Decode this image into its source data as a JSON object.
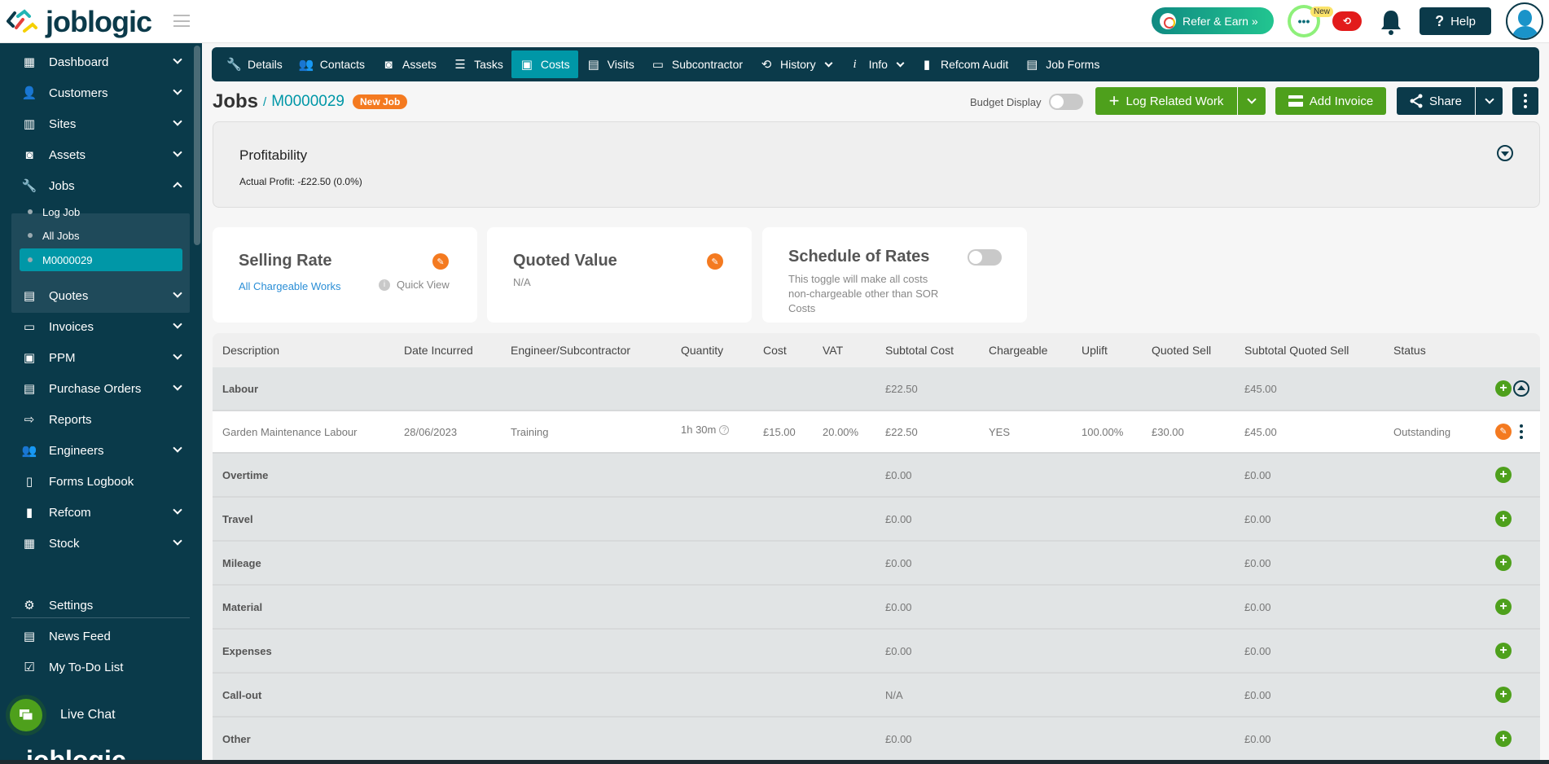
{
  "app": {
    "logo_text": "joblogic"
  },
  "topbar": {
    "refer_label": "Refer & Earn »",
    "chat_badge": "New",
    "chat_icon_text": "•••",
    "sync_icon_text": "⟲",
    "help_label": "Help",
    "help_icon": "?"
  },
  "sidebar": {
    "items": [
      {
        "label": "Dashboard",
        "icon": "▦"
      },
      {
        "label": "Customers",
        "icon": "👤"
      },
      {
        "label": "Sites",
        "icon": "▥"
      },
      {
        "label": "Assets",
        "icon": "◙"
      },
      {
        "label": "Jobs",
        "icon": "🔧"
      },
      {
        "label": "Quotes",
        "icon": "▤"
      },
      {
        "label": "Invoices",
        "icon": "▭"
      },
      {
        "label": "PPM",
        "icon": "▣"
      },
      {
        "label": "Purchase Orders",
        "icon": "▤"
      },
      {
        "label": "Reports",
        "icon": "⇨"
      },
      {
        "label": "Engineers",
        "icon": "👥"
      },
      {
        "label": "Forms Logbook",
        "icon": "▯"
      },
      {
        "label": "Refcom",
        "icon": "▮"
      },
      {
        "label": "Stock",
        "icon": "▦"
      }
    ],
    "jobs_sub": [
      {
        "label": "Log Job"
      },
      {
        "label": "All Jobs"
      },
      {
        "label": "M0000029"
      }
    ],
    "bottom": [
      {
        "label": "Settings",
        "icon": "⚙"
      },
      {
        "label": "News Feed",
        "icon": "▤"
      },
      {
        "label": "My To-Do List",
        "icon": "☑"
      }
    ],
    "live_chat": "Live Chat",
    "bottom_logo": "joblogic"
  },
  "tabs": [
    {
      "label": "Details",
      "icon": "🔧"
    },
    {
      "label": "Contacts",
      "icon": "👥"
    },
    {
      "label": "Assets",
      "icon": "◙"
    },
    {
      "label": "Tasks",
      "icon": "☰"
    },
    {
      "label": "Costs",
      "icon": "▣"
    },
    {
      "label": "Visits",
      "icon": "▤"
    },
    {
      "label": "Subcontractor",
      "icon": "▭"
    },
    {
      "label": "History",
      "icon": "⟲"
    },
    {
      "label": "Info",
      "icon": "i"
    },
    {
      "label": "Refcom Audit",
      "icon": "▮"
    },
    {
      "label": "Job Forms",
      "icon": "▤"
    }
  ],
  "header": {
    "section": "Jobs",
    "separator": "/",
    "job_id": "M0000029",
    "status_badge": "New Job",
    "budget_display_label": "Budget Display",
    "log_related_work": "Log Related Work",
    "add_invoice": "Add Invoice",
    "share": "Share"
  },
  "profitability": {
    "title": "Profitability",
    "actual_profit": "Actual Profit: -£22.50 (0.0%)"
  },
  "cards": {
    "selling_rate": {
      "title": "Selling Rate",
      "link": "All Chargeable Works",
      "quick_view": "Quick View"
    },
    "quoted_value": {
      "title": "Quoted Value",
      "value": "N/A"
    },
    "schedule_of_rates": {
      "title": "Schedule of Rates",
      "description": "This toggle will make all costs non-chargeable other than SOR Costs",
      "enabled": false
    }
  },
  "table": {
    "columns": [
      "Description",
      "Date Incurred",
      "Engineer/Subcontractor",
      "Quantity",
      "Cost",
      "VAT",
      "Subtotal Cost",
      "Chargeable",
      "Uplift",
      "Quoted Sell",
      "Subtotal Quoted Sell",
      "Status"
    ],
    "labour": {
      "name": "Labour",
      "subtotal_cost": "£22.50",
      "subtotal_quoted_sell": "£45.00"
    },
    "labour_item": {
      "description": "Garden Maintenance Labour",
      "date": "28/06/2023",
      "engineer": "Training",
      "quantity": "1h 30m",
      "cost": "£15.00",
      "vat": "20.00%",
      "subtotal_cost": "£22.50",
      "chargeable": "YES",
      "uplift": "100.00%",
      "quoted_sell": "£30.00",
      "subtotal_quoted_sell": "£45.00",
      "status": "Outstanding"
    },
    "categories": [
      {
        "name": "Overtime",
        "subtotal_cost": "£0.00",
        "subtotal_quoted_sell": "£0.00"
      },
      {
        "name": "Travel",
        "subtotal_cost": "£0.00",
        "subtotal_quoted_sell": "£0.00"
      },
      {
        "name": "Mileage",
        "subtotal_cost": "£0.00",
        "subtotal_quoted_sell": "£0.00"
      },
      {
        "name": "Material",
        "subtotal_cost": "£0.00",
        "subtotal_quoted_sell": "£0.00"
      },
      {
        "name": "Expenses",
        "subtotal_cost": "£0.00",
        "subtotal_quoted_sell": "£0.00"
      },
      {
        "name": "Call-out",
        "subtotal_cost": "N/A",
        "subtotal_quoted_sell": "£0.00"
      },
      {
        "name": "Other",
        "subtotal_cost": "£0.00",
        "subtotal_quoted_sell": "£0.00"
      }
    ]
  },
  "colors": {
    "navy": "#0b3a4a",
    "teal": "#0097a7",
    "green": "#4ea01c",
    "orange": "#f47a20"
  }
}
